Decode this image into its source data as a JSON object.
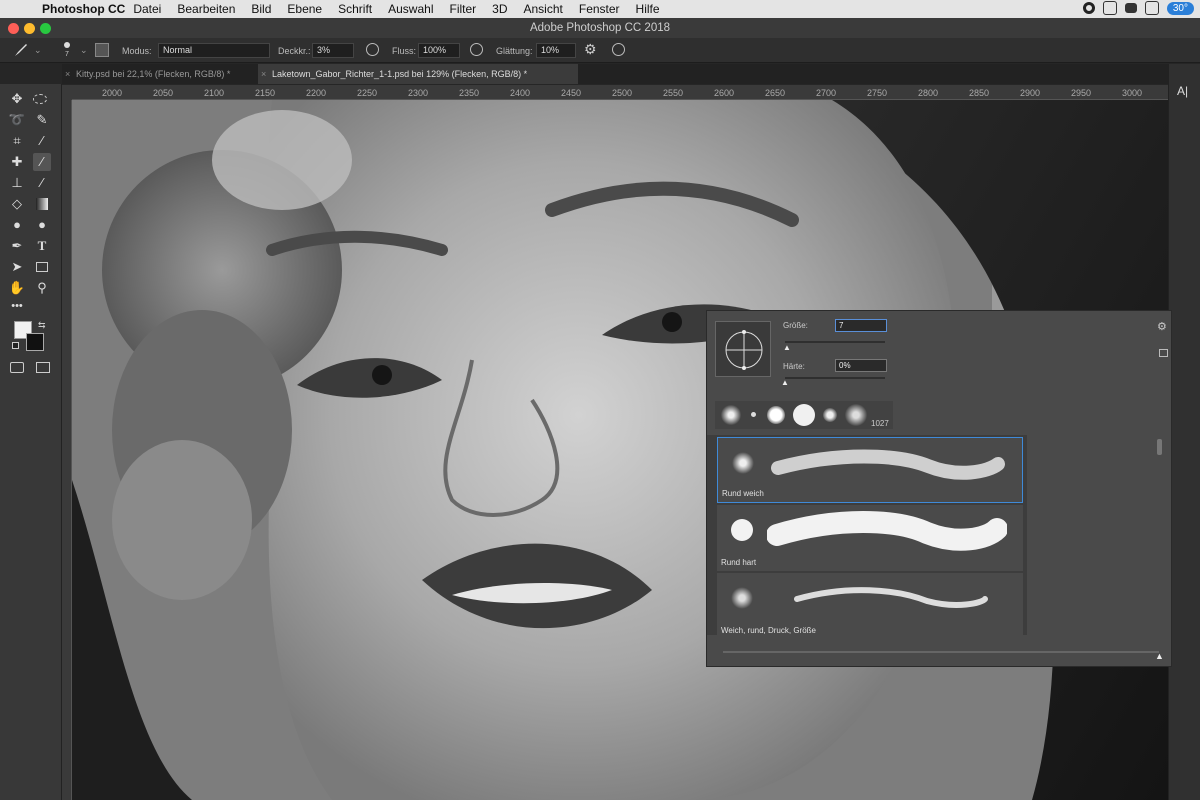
{
  "os_menubar": {
    "app_name": "Photoshop CC",
    "menus": [
      "Datei",
      "Bearbeiten",
      "Bild",
      "Ebene",
      "Schrift",
      "Auswahl",
      "Filter",
      "3D",
      "Ansicht",
      "Fenster",
      "Hilfe"
    ],
    "weather": "30°"
  },
  "window": {
    "title": "Adobe Photoshop CC 2018"
  },
  "options": {
    "brush_size_small": "7",
    "mode_label": "Modus:",
    "mode_value": "Normal",
    "opacity_label": "Deckkr.:",
    "opacity_value": "3%",
    "flow_label": "Fluss:",
    "flow_value": "100%",
    "smoothing_label": "Glättung:",
    "smoothing_value": "10%"
  },
  "tabs": [
    {
      "label": "Kitty.psd bei 22,1% (Flecken, RGB/8) *"
    },
    {
      "label": "Laketown_Gabor_Richter_1-1.psd bei 129% (Flecken, RGB/8) *"
    }
  ],
  "ruler_ticks": [
    "2000",
    "2050",
    "2100",
    "2150",
    "2200",
    "2250",
    "2300",
    "2350",
    "2400",
    "2450",
    "2500",
    "2550",
    "2600",
    "2650",
    "2700",
    "2750",
    "2800",
    "2850",
    "2900",
    "2950",
    "3000"
  ],
  "brush_panel": {
    "size_label": "Größe:",
    "size_value": "7",
    "hardness_label": "Härte:",
    "hardness_value": "0%",
    "recent_count": "1027",
    "presets": [
      {
        "name": "Rund weich"
      },
      {
        "name": "Rund hart"
      },
      {
        "name": "Weich, rund, Druck, Größe"
      }
    ]
  },
  "right_panel": {
    "character_icon_label": "A|"
  }
}
